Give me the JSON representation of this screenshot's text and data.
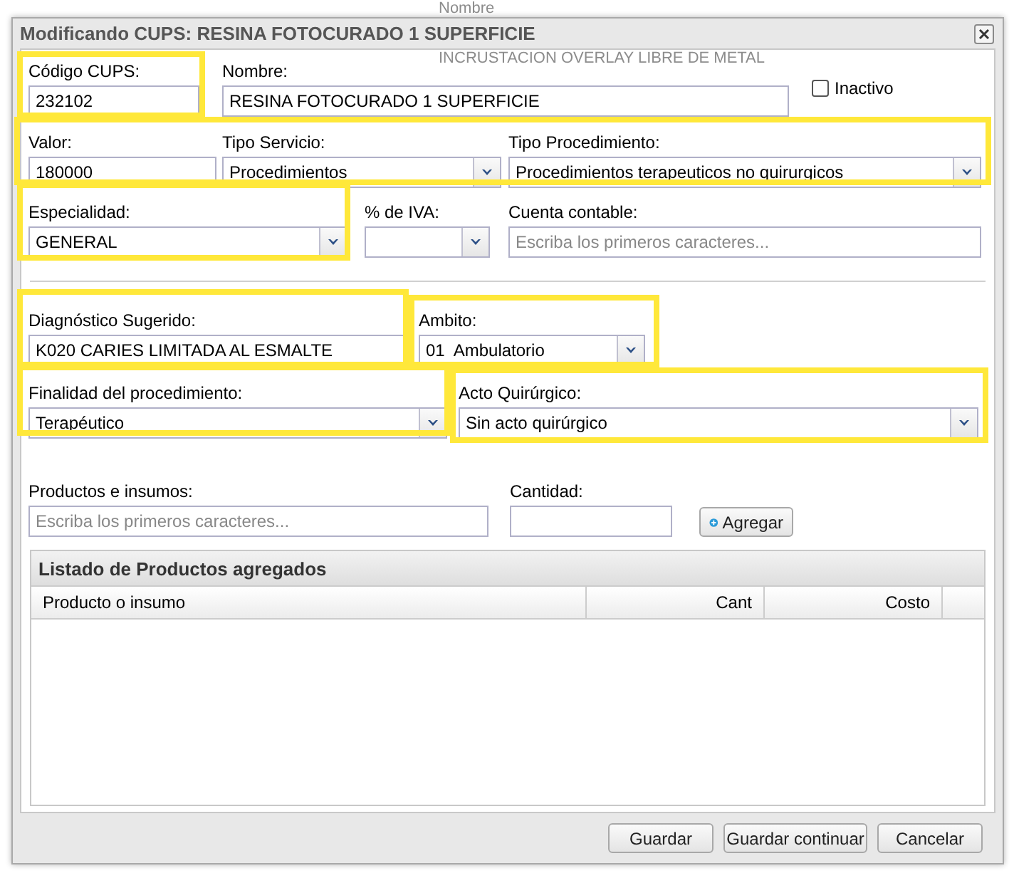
{
  "background": {
    "texts": [
      "Nombre",
      "INCRUSTACION OVERLAY LIBRE DE METAL"
    ]
  },
  "dialog": {
    "title": "Modificando CUPS: RESINA FOTOCURADO 1 SUPERFICIE"
  },
  "form": {
    "rows": [
      [
        {
          "kind": "text",
          "label": "Código CUPS:",
          "value": "232102"
        },
        {
          "kind": "text",
          "label": "Nombre:",
          "value": "RESINA FOTOCURADO 1 SUPERFICIE"
        },
        {
          "kind": "checkbox",
          "label": "Inactivo",
          "checked": false
        }
      ],
      [
        {
          "kind": "text",
          "label": "Valor:",
          "value": "180000"
        },
        {
          "kind": "select",
          "label": "Tipo Servicio:",
          "value": "Procedimientos"
        },
        {
          "kind": "select",
          "label": "Tipo Procedimiento:",
          "value": "Procedimientos terapeuticos no quirurgicos"
        }
      ],
      [
        {
          "kind": "select",
          "label": "Especialidad:",
          "value": "GENERAL"
        },
        {
          "kind": "select",
          "label": "% de IVA:"
        },
        {
          "kind": "text",
          "label": "Cuenta contable:",
          "placeholder": "Escriba los primeros caracteres..."
        }
      ],
      [
        {
          "kind": "text",
          "label": "Diagnóstico Sugerido:",
          "value": "K020 CARIES LIMITADA AL ESMALTE"
        },
        {
          "kind": "select",
          "label": "Ambito:",
          "value": "01  Ambulatorio"
        }
      ],
      [
        {
          "kind": "select",
          "label": "Finalidad del procedimiento:",
          "value": "Terapéutico"
        },
        {
          "kind": "select",
          "label": "Acto Quirúrgico:",
          "value": "Sin acto quirúrgico"
        }
      ],
      [
        {
          "kind": "text",
          "label": "Productos e insumos:",
          "placeholder": "Escriba los primeros caracteres..."
        },
        {
          "kind": "text",
          "label": "Cantidad:"
        },
        {
          "kind": "button",
          "label": "Agregar"
        }
      ]
    ]
  },
  "grid": {
    "title": "Listado de Productos agregados",
    "columns": [
      "Producto o insumo",
      "Cant",
      "Costo"
    ]
  },
  "buttons": [
    "Guardar",
    "Guardar continuar",
    "Cancelar"
  ]
}
